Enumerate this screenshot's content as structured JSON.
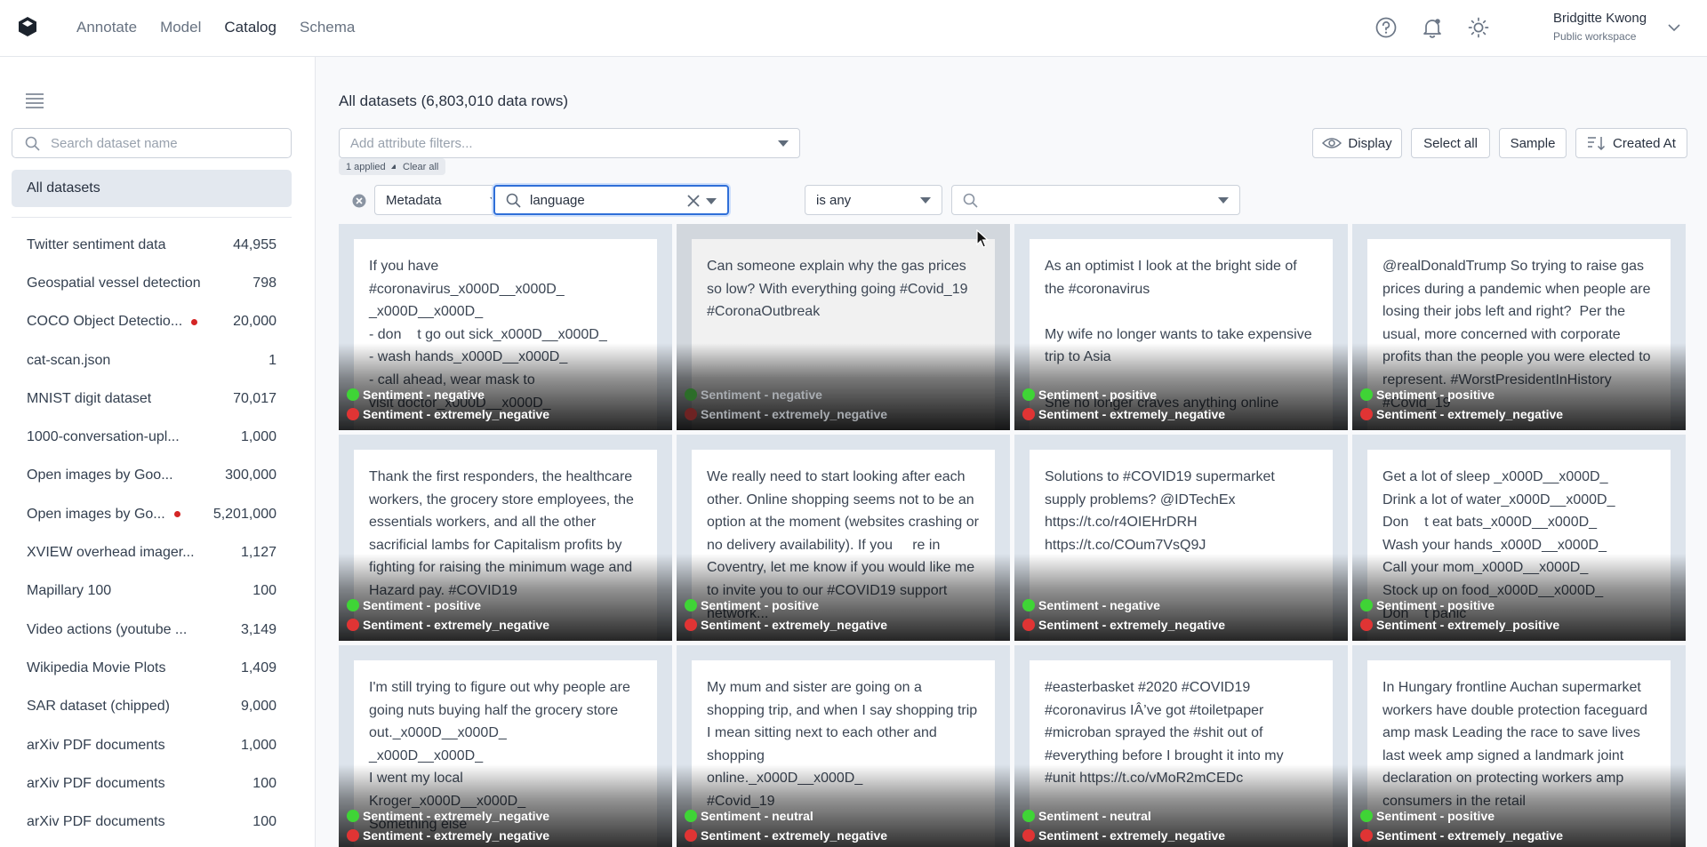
{
  "nav": {
    "links": [
      "Annotate",
      "Model",
      "Catalog",
      "Schema"
    ],
    "active": "Catalog",
    "user_name": "Bridgitte Kwong",
    "workspace": "Public workspace"
  },
  "sidebar": {
    "search_placeholder": "Search dataset name",
    "all_label": "All datasets",
    "datasets": [
      {
        "name": "Twitter sentiment data",
        "count": "44,955",
        "alert": false
      },
      {
        "name": "Geospatial vessel detection",
        "count": "798",
        "alert": false
      },
      {
        "name": "COCO Object Detectio...",
        "count": "20,000",
        "alert": true
      },
      {
        "name": "cat-scan.json",
        "count": "1",
        "alert": false
      },
      {
        "name": "MNIST digit dataset",
        "count": "70,017",
        "alert": false
      },
      {
        "name": "1000-conversation-upl...",
        "count": "1,000",
        "alert": false
      },
      {
        "name": "Open images by Goo...",
        "count": "300,000",
        "alert": false
      },
      {
        "name": "Open images by Go...",
        "count": "5,201,000",
        "alert": true
      },
      {
        "name": "XVIEW overhead imager...",
        "count": "1,127",
        "alert": false
      },
      {
        "name": "Mapillary 100",
        "count": "100",
        "alert": false
      },
      {
        "name": "Video actions (youtube ...",
        "count": "3,149",
        "alert": false
      },
      {
        "name": "Wikipedia Movie Plots",
        "count": "1,409",
        "alert": false
      },
      {
        "name": "SAR dataset (chipped)",
        "count": "9,000",
        "alert": false
      },
      {
        "name": "arXiv PDF documents",
        "count": "1,000",
        "alert": false
      },
      {
        "name": "arXiv PDF documents",
        "count": "100",
        "alert": false
      },
      {
        "name": "arXiv PDF documents",
        "count": "100",
        "alert": false
      }
    ]
  },
  "main": {
    "title": "All datasets (6,803,010 data rows)",
    "attr_placeholder": "Add attribute filters...",
    "applied_label": "1 applied",
    "clear_label": "Clear all",
    "toolbar": {
      "display": "Display",
      "select_all": "Select all",
      "sample": "Sample",
      "sort": "Created At"
    },
    "filter": {
      "type": "Metadata",
      "field": "language",
      "operator": "is any",
      "value": ""
    }
  },
  "colors": {
    "positive_dot": "#3fd436",
    "negative_dot": "#e03434",
    "accent": "#2f6fd8"
  },
  "tiles": [
    {
      "text": "If you have\n#coronavirus_x000D__x000D_\n_x000D__x000D_\n- don    t go out sick_x000D__x000D_\n- wash hands_x000D__x000D_\n- call ahead, wear mask to\nvisit doctor_x000D__x000D_",
      "labels": [
        "Sentiment - negative",
        "Sentiment - extremely_negative"
      ],
      "dim": false
    },
    {
      "text": "Can someone explain why the gas prices so low? With everything going #Covid_19 #CoronaOutbreak",
      "labels": [
        "Sentiment - negative",
        "Sentiment - extremely_negative"
      ],
      "dim": true
    },
    {
      "text": "As an optimist I look at the bright side of the #coronavirus\n\nMy wife no longer wants to take expensive trip to Asia\n\nShe no longer craves anything online",
      "labels": [
        "Sentiment - positive",
        "Sentiment - extremely_negative"
      ],
      "dim": false
    },
    {
      "text": "@realDonaldTrump So trying to raise gas prices during a pandemic when people are losing their jobs left and right?  Per the usual, more concerned with corporate profits than the people you were elected to represent. #WorstPresidentInHistory #Covid_19",
      "labels": [
        "Sentiment - positive",
        "Sentiment - extremely_negative"
      ],
      "dim": false
    },
    {
      "text": "Thank the first responders, the healthcare workers, the grocery store employees, the essentials workers, and all the other sacrificial lambs for Capitalism profits by fighting for raising the minimum wage and Hazard pay. #COVID19",
      "labels": [
        "Sentiment - positive",
        "Sentiment - extremely_negative"
      ],
      "dim": false
    },
    {
      "text": "We really need to start looking after each other. Online shopping seems not to be an option at the moment (websites crashing or no delivery availability). If you     re in Coventry, let me know if you would like me to invite you to our #COVID19 support network...",
      "labels": [
        "Sentiment - positive",
        "Sentiment - extremely_negative"
      ],
      "dim": false
    },
    {
      "text": "Solutions to #COVID19 supermarket supply problems? @IDTechEx\nhttps://t.co/r4OIEHrDRH\nhttps://t.co/COum7VsQ9J",
      "labels": [
        "Sentiment - negative",
        "Sentiment - extremely_negative"
      ],
      "dim": false
    },
    {
      "text": "Get a lot of sleep _x000D__x000D_\nDrink a lot of water_x000D__x000D_\nDon    t eat bats_x000D__x000D_\nWash your hands_x000D__x000D_\nCall your mom_x000D__x000D_\nStock up on food_x000D__x000D_\nDon    t panic",
      "labels": [
        "Sentiment - positive",
        "Sentiment - extremely_positive"
      ],
      "dim": false
    },
    {
      "text": "I'm still trying to figure out why people are going nuts buying half the grocery store out._x000D__x000D_\n_x000D__x000D_\nI went my local\nKroger_x000D__x000D_\nSomething else",
      "labels": [
        "Sentiment - extremely_negative",
        "Sentiment - extremely_negative"
      ],
      "dim": false
    },
    {
      "text": "My mum and sister are going on a shopping trip, and when I say shopping trip I mean sitting next to each other and shopping\nonline._x000D__x000D_\n#Covid_19",
      "labels": [
        "Sentiment - neutral",
        "Sentiment - extremely_negative"
      ],
      "dim": false
    },
    {
      "text": "#easterbasket #2020 #COVID19 #coronavirus IÂ’ve got #toiletpaper #microban sprayed the #shit out of #everything before I brought it into my #unit https://t.co/vMoR2mCEDc",
      "labels": [
        "Sentiment - neutral",
        "Sentiment - extremely_negative"
      ],
      "dim": false
    },
    {
      "text": "In Hungary frontline Auchan supermarket workers have double protection faceguard amp mask Leading the race to save lives last week amp signed a landmark joint declaration on protecting workers amp consumers in the retail",
      "labels": [
        "Sentiment - positive",
        "Sentiment - extremely_negative"
      ],
      "dim": false
    }
  ]
}
